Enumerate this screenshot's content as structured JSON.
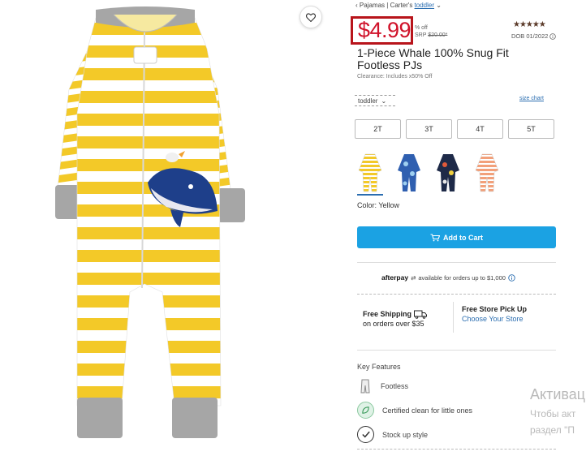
{
  "breadcrumb": {
    "back": "‹ Pajamas",
    "sep": "|",
    "brand": "Carter's",
    "category": "toddler",
    "chevron": "chevron-down-icon"
  },
  "price": {
    "sale": "$4.99",
    "percent_off": "% off",
    "srp_label": "SRP",
    "srp_value": "$20.00*",
    "highlight_color": "#b8141b",
    "price_color": "#d0122a"
  },
  "rating": {
    "stars": "★★★★★",
    "stars_value": 5,
    "dob": "DOB 01/2022",
    "info_icon": "info-icon"
  },
  "product": {
    "title": "1-Piece Whale 100% Snug Fit Footless PJs",
    "clearance": "Clearance: Includes x50% Off"
  },
  "size_selector": {
    "value": "toddler",
    "size_chart": "size chart",
    "sizes": [
      "2T",
      "3T",
      "4T",
      "5T"
    ]
  },
  "colors": {
    "label": "Color: Yellow",
    "swatches": [
      "yellow-striped",
      "blue-print",
      "navy-print",
      "peach-striped"
    ],
    "selected": 0
  },
  "cart": {
    "label": "Add to Cart",
    "icon": "cart-icon",
    "color": "#1ba2e3"
  },
  "afterpay": {
    "brand": "afterpay",
    "text": "available for orders up to $1,000"
  },
  "shipping": {
    "title": "Free Shipping",
    "subtitle": "on orders over $35",
    "icon": "truck-icon"
  },
  "pickup": {
    "title": "Free Store Pick Up",
    "link": "Choose Your Store"
  },
  "features": {
    "heading": "Key Features",
    "items": [
      {
        "label": "Footless",
        "icon": "footless-icon"
      },
      {
        "label": "Certified clean for little ones",
        "icon": "leaf-icon"
      },
      {
        "label": "Stock up style",
        "icon": "check-icon"
      }
    ]
  },
  "watermark": {
    "line1": "Активац",
    "line2": "Чтобы акт",
    "line3": "раздел \"П"
  }
}
